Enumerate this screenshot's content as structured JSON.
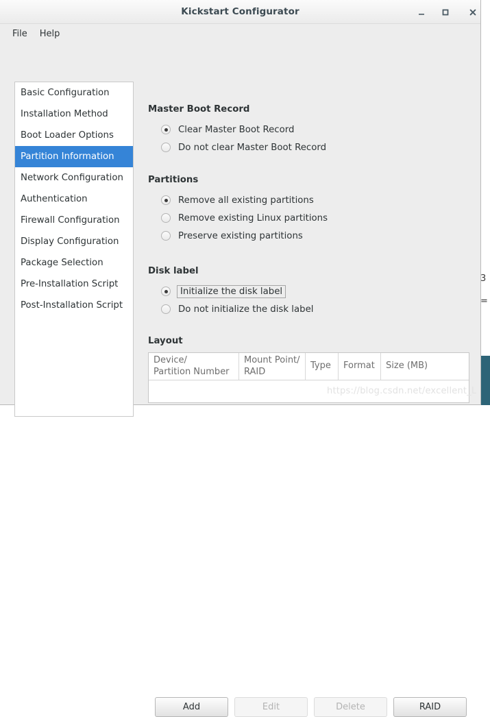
{
  "window": {
    "title": "Kickstart Configurator",
    "controls": [
      {
        "name": "minimize",
        "glyph": "_"
      },
      {
        "name": "maximize",
        "glyph": "□"
      },
      {
        "name": "close",
        "glyph": "×"
      }
    ]
  },
  "menubar": {
    "items": [
      {
        "label": "File"
      },
      {
        "label": "Help"
      }
    ]
  },
  "sidebar": {
    "items": [
      {
        "label": "Basic Configuration",
        "selected": false
      },
      {
        "label": "Installation Method",
        "selected": false
      },
      {
        "label": "Boot Loader Options",
        "selected": false
      },
      {
        "label": "Partition Information",
        "selected": true
      },
      {
        "label": "Network Configuration",
        "selected": false
      },
      {
        "label": "Authentication",
        "selected": false
      },
      {
        "label": "Firewall Configuration",
        "selected": false
      },
      {
        "label": "Display Configuration",
        "selected": false
      },
      {
        "label": "Package Selection",
        "selected": false
      },
      {
        "label": "Pre-Installation Script",
        "selected": false
      },
      {
        "label": "Post-Installation Script",
        "selected": false
      }
    ],
    "selected_index": 3,
    "selection_color": "#3584d7"
  },
  "main": {
    "master_boot_record": {
      "title": "Master Boot Record",
      "options": [
        {
          "label": "Clear Master Boot Record",
          "selected": true
        },
        {
          "label": "Do not clear Master Boot Record",
          "selected": false
        }
      ]
    },
    "partitions": {
      "title": "Partitions",
      "options": [
        {
          "label": "Remove all existing partitions",
          "selected": true
        },
        {
          "label": "Remove existing Linux partitions",
          "selected": false
        },
        {
          "label": "Preserve existing partitions",
          "selected": false
        }
      ]
    },
    "disk_label": {
      "title": "Disk label",
      "options": [
        {
          "label": "Initialize the disk label",
          "selected": true,
          "focused": true
        },
        {
          "label": "Do not initialize the disk label",
          "selected": false,
          "focused": false
        }
      ]
    },
    "layout": {
      "title": "Layout",
      "columns": [
        "Device/\nPartition Number",
        "Mount Point/\nRAID",
        "Type",
        "Format",
        "Size (MB)"
      ],
      "rows": [],
      "buttons": [
        {
          "label": "Add",
          "enabled": true
        },
        {
          "label": "Edit",
          "enabled": false
        },
        {
          "label": "Delete",
          "enabled": false
        },
        {
          "label": "RAID",
          "enabled": true
        }
      ]
    }
  },
  "watermark": {
    "text": "https://blog.csdn.net/excellent_L"
  },
  "background": {
    "glyph_1": "3",
    "glyph_2": "=",
    "panel_color": "#2d6477"
  }
}
